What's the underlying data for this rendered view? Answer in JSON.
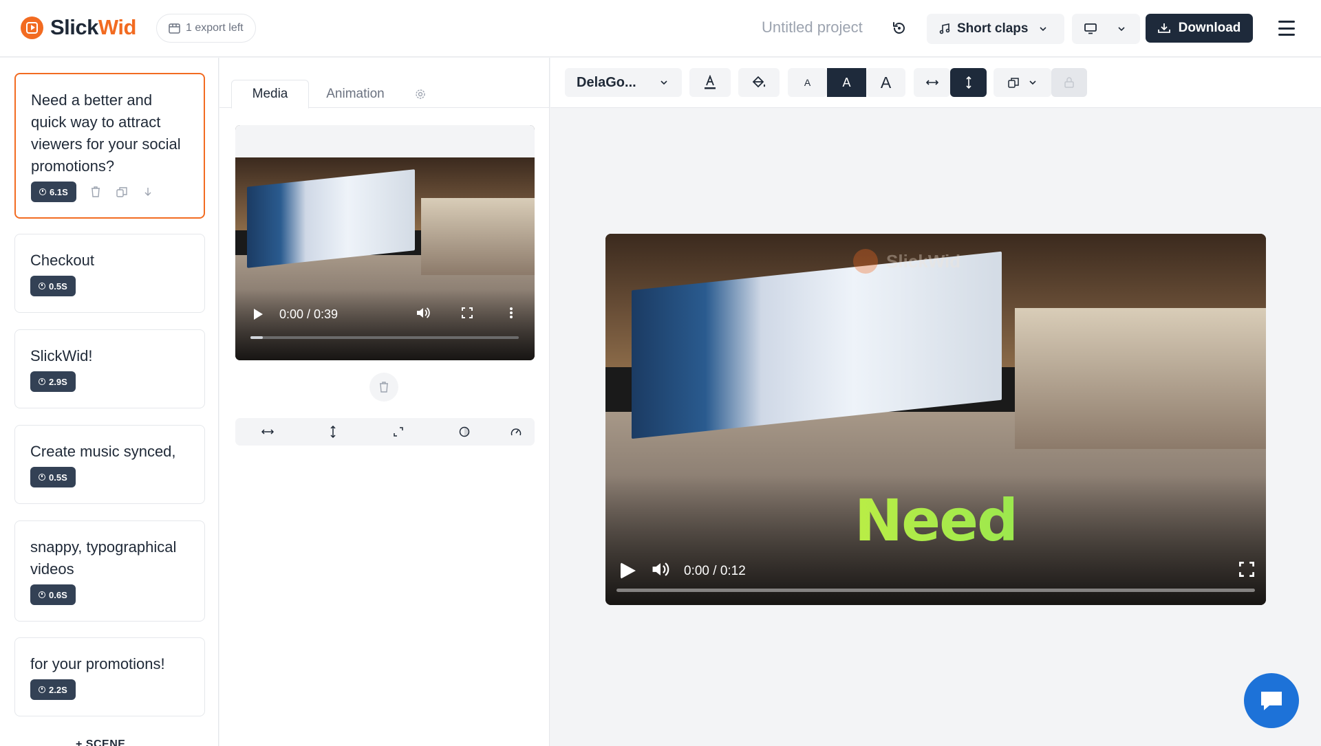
{
  "header": {
    "logo": {
      "part1": "Slick",
      "part2": "Wid"
    },
    "export_pill": "1 export left",
    "project_title": "Untitled project",
    "music_label": "Short claps",
    "download_label": "Download"
  },
  "scenes": [
    {
      "text": "Need a better and quick way to attract viewers for your social promotions?",
      "duration": "6.1S",
      "active": true
    },
    {
      "text": "Checkout",
      "duration": "0.5S"
    },
    {
      "text": "SlickWid!",
      "duration": "2.9S"
    },
    {
      "text": "Create music synced,",
      "duration": "0.5S"
    },
    {
      "text": "snappy, typographical videos",
      "duration": "0.6S"
    },
    {
      "text": "for your promotions!",
      "duration": "2.2S"
    }
  ],
  "add_scene_label": "+ SCENE",
  "media_panel": {
    "tabs": [
      "Media",
      "Animation"
    ],
    "thumb_time": "0:00 / 0:39"
  },
  "toolbar": {
    "font_name": "DelaGo..."
  },
  "preview": {
    "overlay_text": "Need",
    "watermark": "SlickWid",
    "time": "0:00 / 0:12"
  },
  "colors": {
    "brand": "#f26b21",
    "dark": "#1e2a3b",
    "chat": "#1d72d8"
  }
}
